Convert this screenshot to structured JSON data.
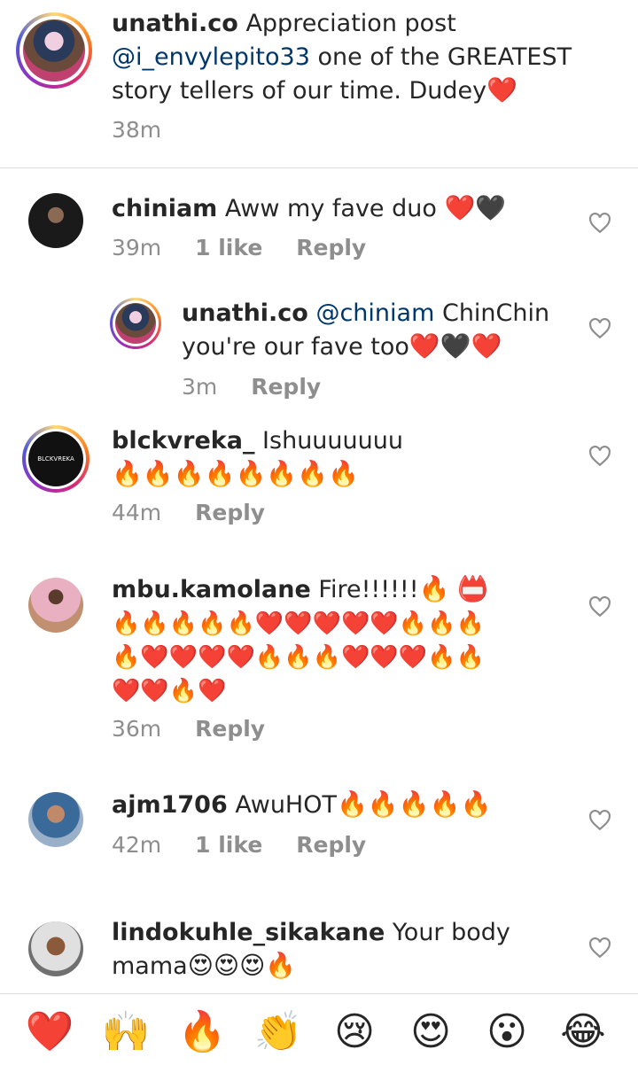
{
  "caption": {
    "username": "unathi.co",
    "text_part1": "Appreciation post",
    "mention": "@i_envylepito33",
    "text_part2": "one of the GREATEST",
    "text_part3": "story tellers of our time. Dudey",
    "emoji": "❤️",
    "time": "38m"
  },
  "comments": [
    {
      "username": "chiniam",
      "text": "Aww my fave duo",
      "emoji": "❤️🖤",
      "time": "39m",
      "likes": "1 like",
      "reply": "Reply"
    },
    {
      "username": "unathi.co",
      "mention": "@chiniam",
      "text": "ChinChin",
      "text2": "you're our fave too",
      "emoji": "❤️🖤❤️",
      "time": "3m",
      "reply": "Reply"
    },
    {
      "username": "blckvreka_",
      "text": "Ishuuuuuuu",
      "emoji": "🔥🔥🔥🔥🔥🔥🔥🔥",
      "time": "44m",
      "reply": "Reply",
      "avatar_text": "BLCKVREKA"
    },
    {
      "username": "mbu.kamolane",
      "text": "Fire!!!!!!",
      "emoji_inline": "🔥 📛",
      "emoji_line1": "🔥🔥🔥🔥🔥❤️❤️❤️❤️❤️🔥🔥🔥",
      "emoji_line2": "🔥❤️❤️❤️❤️🔥🔥🔥❤️❤️❤️🔥🔥",
      "emoji_line3": "❤️❤️🔥❤️",
      "time": "36m",
      "reply": "Reply"
    },
    {
      "username": "ajm1706",
      "text": "AwuHOT",
      "emoji": "🔥🔥🔥🔥🔥",
      "time": "42m",
      "likes": "1 like",
      "reply": "Reply"
    },
    {
      "username": "lindokuhle_sikakane",
      "text": "Your body",
      "text2": "mama",
      "emoji": "😍😍😍🔥"
    }
  ],
  "reactions": [
    "❤️",
    "🙌",
    "🔥",
    "👏",
    "😢",
    "😍",
    "😮",
    "😂"
  ],
  "colors": {
    "mention": "#00376b",
    "meta": "#8e8e8e",
    "divider": "#dbdbdb"
  },
  "icons": [
    "heart-outline-icon"
  ]
}
